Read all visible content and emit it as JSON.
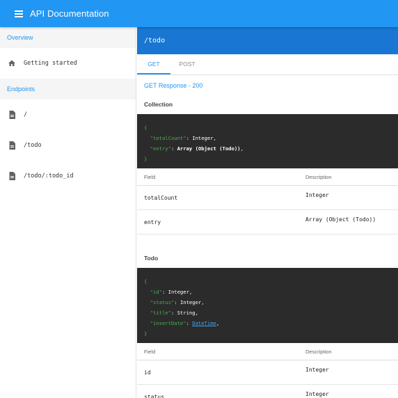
{
  "app": {
    "title": "API Documentation"
  },
  "sidebar": {
    "sections": [
      {
        "title": "Overview"
      },
      {
        "title": "Endpoints"
      }
    ],
    "overview_items": [
      {
        "label": "Getting started",
        "icon": "home-icon"
      }
    ],
    "endpoint_items": [
      {
        "label": "/",
        "icon": "document-icon"
      },
      {
        "label": "/todo",
        "icon": "document-icon"
      },
      {
        "label": "/todo/:todo_id",
        "icon": "document-icon"
      }
    ]
  },
  "main": {
    "route": "/todo",
    "tabs": [
      {
        "label": "GET",
        "active": true
      },
      {
        "label": "POST",
        "active": false
      }
    ],
    "response_title": "GET Response - 200",
    "collection": {
      "label": "Collection",
      "code": {
        "open": "{",
        "close": "}",
        "lines": [
          {
            "key": "\"totalCount\"",
            "value": "Integer"
          },
          {
            "key": "\"entry\"",
            "value": "Array (Object (Todo))"
          }
        ]
      },
      "table": {
        "headers": [
          "Field",
          "Description"
        ],
        "rows": [
          {
            "field": "totalCount",
            "description": "Integer"
          },
          {
            "field": "entry",
            "description": "Array (Object (Todo))"
          }
        ]
      }
    },
    "todo": {
      "label": "Todo",
      "code": {
        "open": "{",
        "close": "}",
        "lines": [
          {
            "key": "\"id\"",
            "value": "Integer"
          },
          {
            "key": "\"status\"",
            "value": "Integer"
          },
          {
            "key": "\"title\"",
            "value": "String"
          },
          {
            "key": "\"insertDate\"",
            "value": "DateTime"
          }
        ]
      },
      "table": {
        "headers": [
          "Field",
          "Description"
        ],
        "rows": [
          {
            "field": "id",
            "description": "Integer"
          },
          {
            "field": "status",
            "description": "Integer"
          }
        ]
      }
    }
  },
  "colors": {
    "appbar": "#2196f3",
    "route_header": "#1976d2",
    "code_bg": "#2b2b2b",
    "code_key": "#4caf50"
  }
}
